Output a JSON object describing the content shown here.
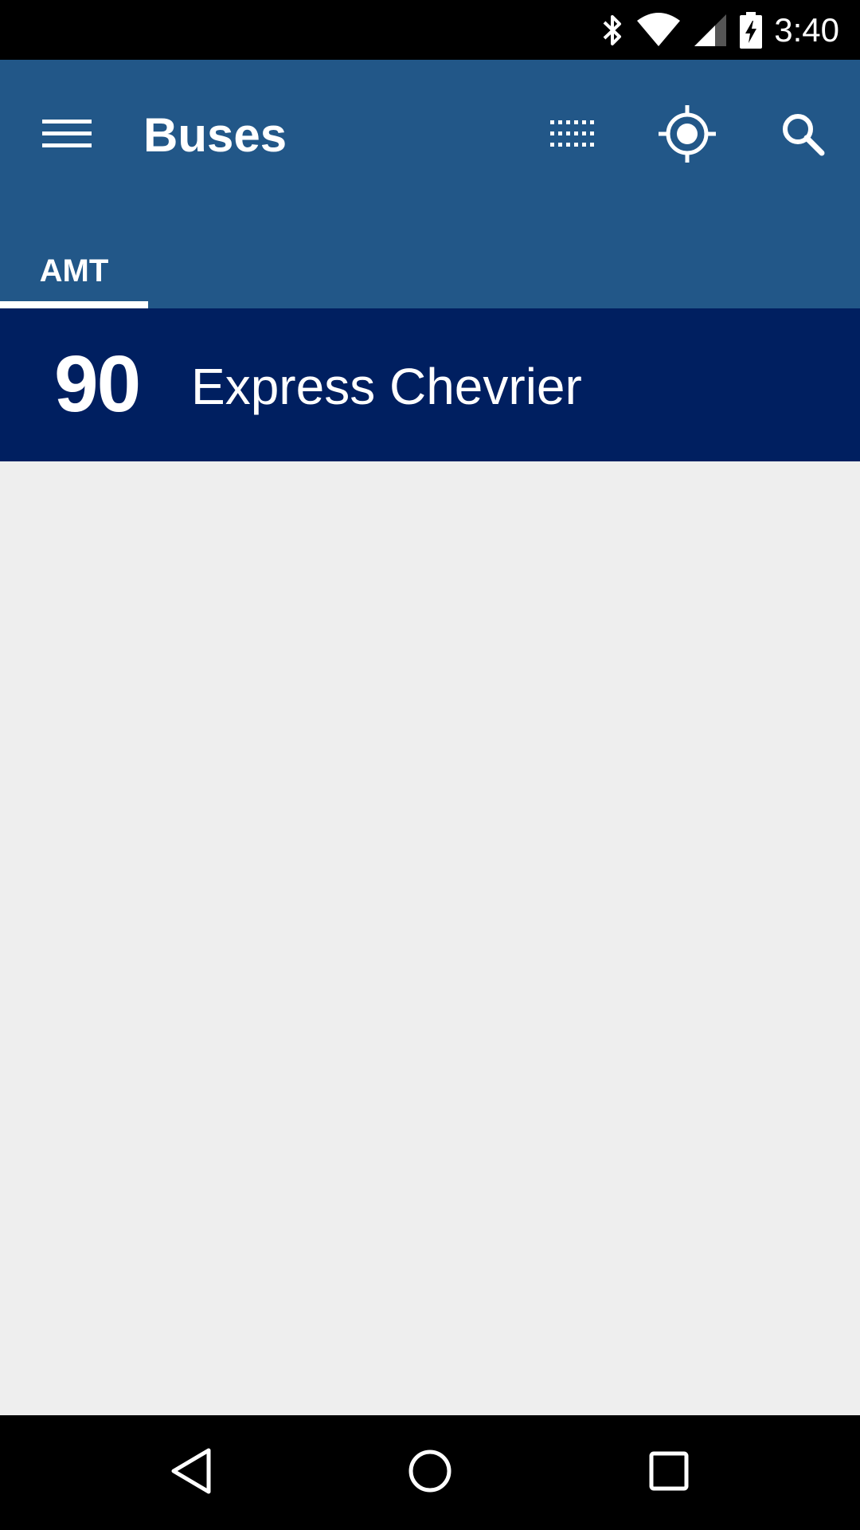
{
  "status_bar": {
    "time": "3:40",
    "icons": [
      "bluetooth-icon",
      "wifi-icon",
      "cell-signal-icon",
      "battery-charging-icon"
    ]
  },
  "app_bar": {
    "title": "Buses",
    "color": "#225788",
    "actions": [
      "grid-icon",
      "my-location-icon",
      "search-icon"
    ]
  },
  "tabs": [
    {
      "label": "AMT",
      "selected": true
    }
  ],
  "routes": [
    {
      "number": "90",
      "name": "Express Chevrier",
      "color": "#001f60"
    }
  ],
  "nav_bar": {
    "buttons": [
      "back-icon",
      "home-icon",
      "recents-icon"
    ]
  }
}
